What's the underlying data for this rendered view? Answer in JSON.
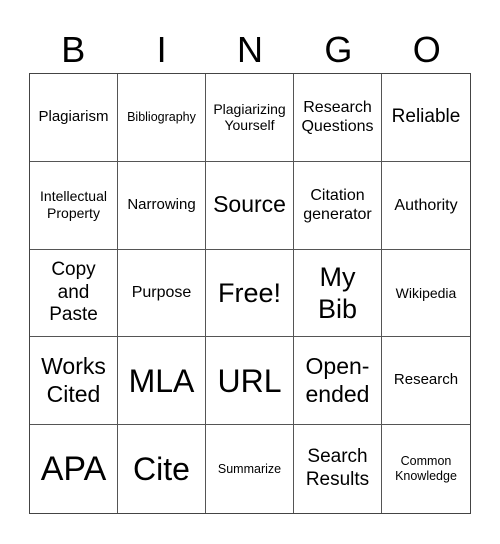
{
  "header": {
    "letters": [
      "B",
      "I",
      "N",
      "G",
      "O"
    ]
  },
  "cells": [
    "Plagiarism",
    "Bibliography",
    "Plagiarizing Yourself",
    "Research Questions",
    "Reliable",
    "Intellectual Property",
    "Narrowing",
    "Source",
    "Citation generator",
    "Authority",
    "Copy and Paste",
    "Purpose",
    "Free!",
    "My Bib",
    "Wikipedia",
    "Works Cited",
    "MLA",
    "URL",
    "Open-ended",
    "Research",
    "APA",
    "Cite",
    "Summarize",
    "Search Results",
    "Common Knowledge"
  ]
}
